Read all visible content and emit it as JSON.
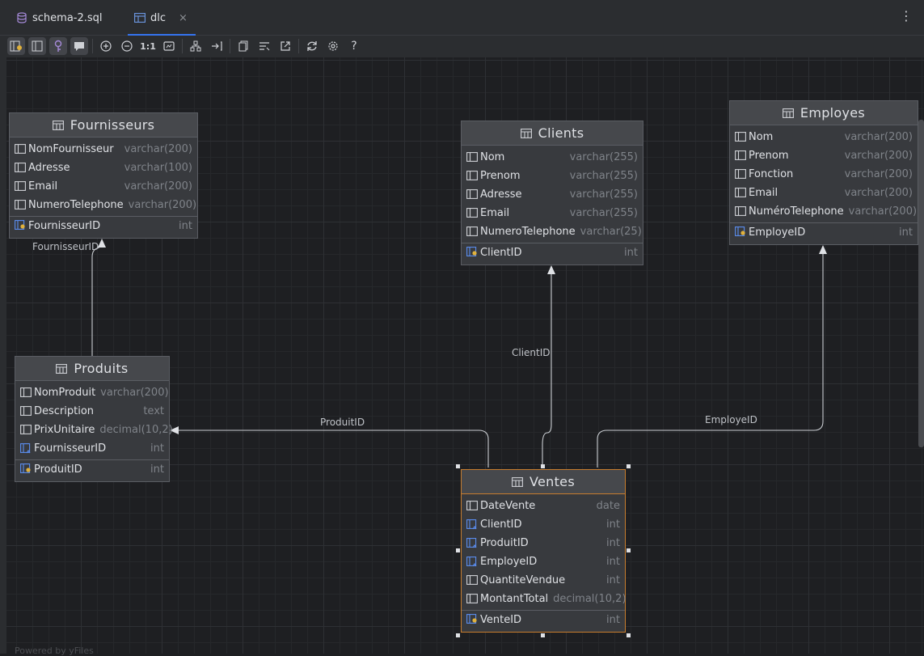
{
  "tabs": [
    {
      "label": "schema-2.sql",
      "icon": "database-icon"
    },
    {
      "label": "dlc",
      "icon": "diagram-icon",
      "close": "×"
    }
  ],
  "toolbar": {
    "zoom_actual_label": "1:1",
    "help_label": "?"
  },
  "watermark": "Powered by yFiles",
  "edges": {
    "fournisseur": "FournisseurID",
    "client": "ClientID",
    "produit": "ProduitID",
    "employe": "EmployeID"
  },
  "tables": {
    "fournisseurs": {
      "name": "Fournisseurs",
      "columns": [
        {
          "name": "NomFournisseur",
          "type": "varchar(200)",
          "kind": "column"
        },
        {
          "name": "Adresse",
          "type": "varchar(100)",
          "kind": "column"
        },
        {
          "name": "Email",
          "type": "varchar(200)",
          "kind": "column"
        },
        {
          "name": "NumeroTelephone",
          "type": "varchar(200)",
          "kind": "column"
        }
      ],
      "pk": {
        "name": "FournisseurID",
        "type": "int"
      }
    },
    "clients": {
      "name": "Clients",
      "columns": [
        {
          "name": "Nom",
          "type": "varchar(255)"
        },
        {
          "name": "Prenom",
          "type": "varchar(255)"
        },
        {
          "name": "Adresse",
          "type": "varchar(255)"
        },
        {
          "name": "Email",
          "type": "varchar(255)"
        },
        {
          "name": "NumeroTelephone",
          "type": "varchar(25)"
        }
      ],
      "pk": {
        "name": "ClientID",
        "type": "int"
      }
    },
    "employes": {
      "name": "Employes",
      "columns": [
        {
          "name": "Nom",
          "type": "varchar(200)"
        },
        {
          "name": "Prenom",
          "type": "varchar(200)"
        },
        {
          "name": "Fonction",
          "type": "varchar(200)"
        },
        {
          "name": "Email",
          "type": "varchar(200)"
        },
        {
          "name": "NuméroTelephone",
          "type": "varchar(200)"
        }
      ],
      "pk": {
        "name": "EmployeID",
        "type": "int"
      }
    },
    "produits": {
      "name": "Produits",
      "columns": [
        {
          "name": "NomProduit",
          "type": "varchar(200)"
        },
        {
          "name": "Description",
          "type": "text"
        },
        {
          "name": "PrixUnitaire",
          "type": "decimal(10,2)"
        },
        {
          "name": "FournisseurID",
          "type": "int"
        }
      ],
      "pk": {
        "name": "ProduitID",
        "type": "int"
      }
    },
    "ventes": {
      "name": "Ventes",
      "columns": [
        {
          "name": "DateVente",
          "type": "date"
        },
        {
          "name": "ClientID",
          "type": "int"
        },
        {
          "name": "ProduitID",
          "type": "int"
        },
        {
          "name": "EmployeID",
          "type": "int"
        },
        {
          "name": "QuantiteVendue",
          "type": "int"
        },
        {
          "name": "MontantTotal",
          "type": "decimal(10,2)"
        }
      ],
      "pk": {
        "name": "VenteID",
        "type": "int"
      }
    }
  }
}
